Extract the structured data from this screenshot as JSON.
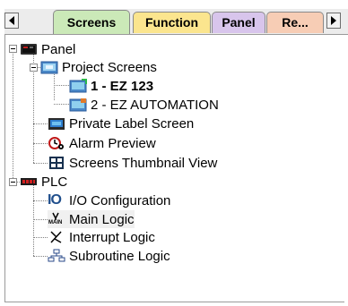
{
  "tabs": [
    {
      "label": "Screens",
      "active": true
    },
    {
      "label": "Function",
      "active": false
    },
    {
      "label": "Panel",
      "active": false
    },
    {
      "label": "Re...",
      "active": false
    }
  ],
  "tree": {
    "panel": {
      "label": "Panel",
      "project_screens": {
        "label": "Project Screens",
        "children": [
          "1 - EZ 123",
          "2 - EZ AUTOMATION"
        ]
      },
      "private_label": "Private Label Screen",
      "alarm_preview": "Alarm Preview",
      "thumbnail_view": "Screens Thumbnail View"
    },
    "plc": {
      "label": "PLC",
      "io_configuration": "I/O Configuration",
      "main_logic": "Main Logic",
      "interrupt_logic": "Interrupt Logic",
      "subroutine_logic": "Subroutine Logic"
    }
  },
  "icons": {
    "io_glyph": "IO",
    "main_glyph": "MAIN"
  }
}
